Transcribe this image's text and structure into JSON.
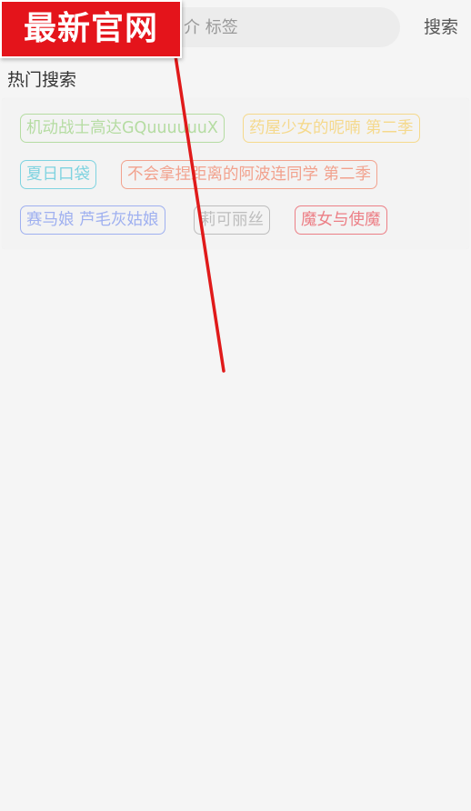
{
  "watermark": {
    "text": "最新官网"
  },
  "search": {
    "placeholder": "介 标签",
    "button_label": "搜索"
  },
  "hot_search": {
    "title": "热门搜索",
    "tags": [
      {
        "label": "机动战士高达GQuuuuuuX",
        "color": "#b5dca2"
      },
      {
        "label": "药屋少女的呢喃 第二季",
        "color": "#f5d98c"
      },
      {
        "label": "夏日口袋",
        "color": "#7fd3e0"
      },
      {
        "label": "不会拿捏距离的阿波连同学 第二季",
        "color": "#f2a28e"
      },
      {
        "label": "赛马娘 芦毛灰姑娘",
        "color": "#9fb0f0"
      },
      {
        "label": "莉可丽丝",
        "color": "#bdbdbd"
      },
      {
        "label": "魔女与使魔",
        "color": "#ec7f86"
      }
    ]
  }
}
